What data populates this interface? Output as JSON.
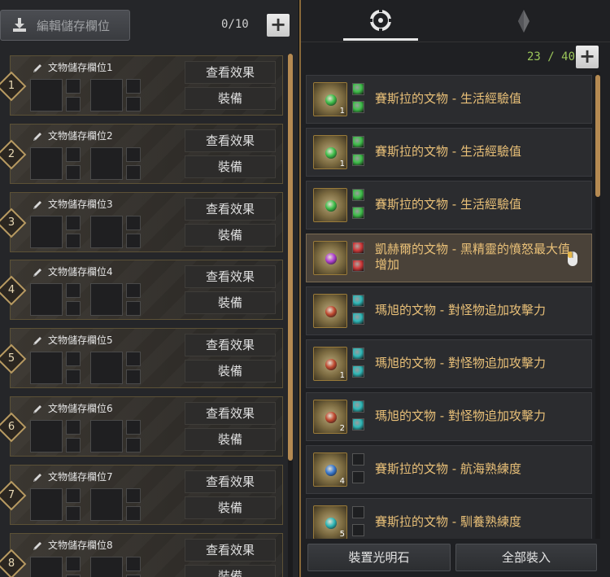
{
  "left_panel": {
    "edit_button_label": "編輯儲存欄位",
    "slot_count": "0/10",
    "slots": [
      {
        "number": "1",
        "name": "文物儲存欄位1",
        "view_label": "查看效果",
        "equip_label": "裝備"
      },
      {
        "number": "2",
        "name": "文物儲存欄位2",
        "view_label": "查看效果",
        "equip_label": "裝備"
      },
      {
        "number": "3",
        "name": "文物儲存欄位3",
        "view_label": "查看效果",
        "equip_label": "裝備"
      },
      {
        "number": "4",
        "name": "文物儲存欄位4",
        "view_label": "查看效果",
        "equip_label": "裝備"
      },
      {
        "number": "5",
        "name": "文物儲存欄位5",
        "view_label": "查看效果",
        "equip_label": "裝備"
      },
      {
        "number": "6",
        "name": "文物儲存欄位6",
        "view_label": "查看效果",
        "equip_label": "裝備"
      },
      {
        "number": "7",
        "name": "文物儲存欄位7",
        "view_label": "查看效果",
        "equip_label": "裝備"
      },
      {
        "number": "8",
        "name": "文物儲存欄位8",
        "view_label": "查看效果",
        "equip_label": "裝備"
      }
    ]
  },
  "right_panel": {
    "tabs": [
      {
        "icon": "target-circle-icon",
        "active": true
      },
      {
        "icon": "diamond-crystal-icon",
        "active": false
      }
    ],
    "item_count": "23 / 40",
    "items": [
      {
        "name": "賽斯拉的文物 - 生活經驗值",
        "gem_color": "#3fbf4a",
        "level": "1",
        "slot_colors": [
          "#3fbf4a",
          "#3fbf4a"
        ],
        "selected": false
      },
      {
        "name": "賽斯拉的文物 - 生活經驗值",
        "gem_color": "#3fbf4a",
        "level": "1",
        "slot_colors": [
          "#3fbf4a",
          "#3fbf4a"
        ],
        "selected": false
      },
      {
        "name": "賽斯拉的文物 - 生活經驗值",
        "gem_color": "#3fbf4a",
        "level": "",
        "slot_colors": [
          "#3fbf4a",
          "#3fbf4a"
        ],
        "selected": false
      },
      {
        "name": "凱赫爾的文物 - 黑精靈的憤怒最大值增加",
        "gem_color": "#b040d0",
        "level": "",
        "slot_colors": [
          "#d03a3a",
          "#d03a3a"
        ],
        "selected": true
      },
      {
        "name": "瑪旭的文物 - 對怪物追加攻擊力",
        "gem_color": "#c04a30",
        "level": "",
        "slot_colors": [
          "#2fb8b8",
          "#2fb8b8"
        ],
        "selected": false
      },
      {
        "name": "瑪旭的文物 - 對怪物追加攻擊力",
        "gem_color": "#c04a30",
        "level": "1",
        "slot_colors": [
          "#2fb8b8",
          "#2fb8b8"
        ],
        "selected": false
      },
      {
        "name": "瑪旭的文物 - 對怪物追加攻擊力",
        "gem_color": "#c04a30",
        "level": "2",
        "slot_colors": [
          "#2fb8b8",
          "#2fb8b8"
        ],
        "selected": false
      },
      {
        "name": "賽斯拉的文物 - 航海熟練度",
        "gem_color": "#3a7ad0",
        "level": "4",
        "slot_colors": [
          "",
          ""
        ],
        "selected": false
      },
      {
        "name": "賽斯拉的文物 - 馴養熟練度",
        "gem_color": "#2fb8b8",
        "level": "5",
        "slot_colors": [
          "",
          ""
        ],
        "selected": false
      }
    ],
    "install_button_label": "裝置光明石",
    "load_all_button_label": "全部裝入"
  },
  "colors": {
    "item_name": "#e9c078",
    "counter_right": "#9bc65a",
    "scroll_thumb": "#b58a52"
  }
}
